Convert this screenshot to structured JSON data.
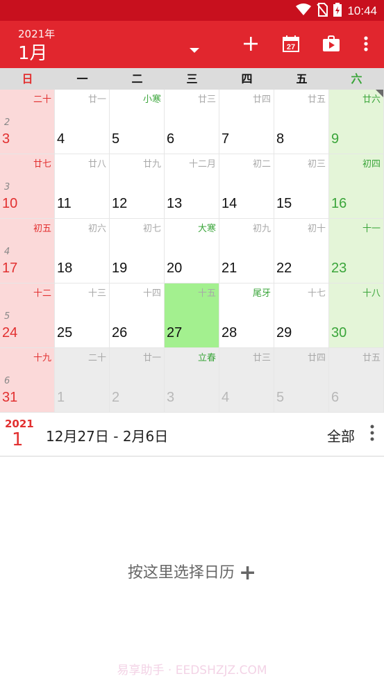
{
  "status_bar": {
    "time": "10:44"
  },
  "header": {
    "year": "2021年",
    "month": "1月"
  },
  "weekdays": [
    "日",
    "一",
    "二",
    "三",
    "四",
    "五",
    "六"
  ],
  "weeks": [
    {
      "week_no": "2",
      "days": [
        {
          "day": "3",
          "lunar": "二十",
          "kind": "sun"
        },
        {
          "day": "4",
          "lunar": "廿一"
        },
        {
          "day": "5",
          "lunar": "小寒",
          "term": true
        },
        {
          "day": "6",
          "lunar": "廿三"
        },
        {
          "day": "7",
          "lunar": "廿四"
        },
        {
          "day": "8",
          "lunar": "廿五"
        },
        {
          "day": "9",
          "lunar": "廿六",
          "kind": "sat",
          "term": true
        }
      ]
    },
    {
      "week_no": "3",
      "days": [
        {
          "day": "10",
          "lunar": "廿七",
          "kind": "sun"
        },
        {
          "day": "11",
          "lunar": "廿八"
        },
        {
          "day": "12",
          "lunar": "廿九"
        },
        {
          "day": "13",
          "lunar": "十二月"
        },
        {
          "day": "14",
          "lunar": "初二"
        },
        {
          "day": "15",
          "lunar": "初三"
        },
        {
          "day": "16",
          "lunar": "初四",
          "kind": "sat",
          "term": true
        }
      ]
    },
    {
      "week_no": "4",
      "days": [
        {
          "day": "17",
          "lunar": "初五",
          "kind": "sun"
        },
        {
          "day": "18",
          "lunar": "初六"
        },
        {
          "day": "19",
          "lunar": "初七"
        },
        {
          "day": "20",
          "lunar": "大寒",
          "term": true
        },
        {
          "day": "21",
          "lunar": "初九"
        },
        {
          "day": "22",
          "lunar": "初十"
        },
        {
          "day": "23",
          "lunar": "十一",
          "kind": "sat",
          "term": true
        }
      ]
    },
    {
      "week_no": "5",
      "days": [
        {
          "day": "24",
          "lunar": "十二",
          "kind": "sun"
        },
        {
          "day": "25",
          "lunar": "十三"
        },
        {
          "day": "26",
          "lunar": "十四"
        },
        {
          "day": "27",
          "lunar": "十五",
          "kind": "today"
        },
        {
          "day": "28",
          "lunar": "尾牙",
          "term": true
        },
        {
          "day": "29",
          "lunar": "十七"
        },
        {
          "day": "30",
          "lunar": "十八",
          "kind": "sat",
          "term": true
        }
      ]
    },
    {
      "week_no": "6",
      "days": [
        {
          "day": "31",
          "lunar": "十九",
          "kind": "sun"
        },
        {
          "day": "1",
          "lunar": "二十",
          "kind": "other"
        },
        {
          "day": "2",
          "lunar": "廿一",
          "kind": "other"
        },
        {
          "day": "3",
          "lunar": "立春",
          "kind": "other",
          "term": true
        },
        {
          "day": "4",
          "lunar": "廿三",
          "kind": "other"
        },
        {
          "day": "5",
          "lunar": "廿四",
          "kind": "other"
        },
        {
          "day": "6",
          "lunar": "廿五",
          "kind": "other"
        }
      ]
    }
  ],
  "agenda": {
    "year": "2021",
    "month": "1",
    "range": "12月27日 - 2月6日",
    "filter": "全部",
    "choose_calendar": "按这里选择日历",
    "choose_plus": "+"
  },
  "watermark": "易享助手 · EEDSHZJZ.COM",
  "colors": {
    "primary": "#e1262e",
    "status": "#c8101e",
    "today": "#a3f08f",
    "sunday_bg": "#fbd9d9",
    "saturday_bg": "#e4f5d8"
  }
}
